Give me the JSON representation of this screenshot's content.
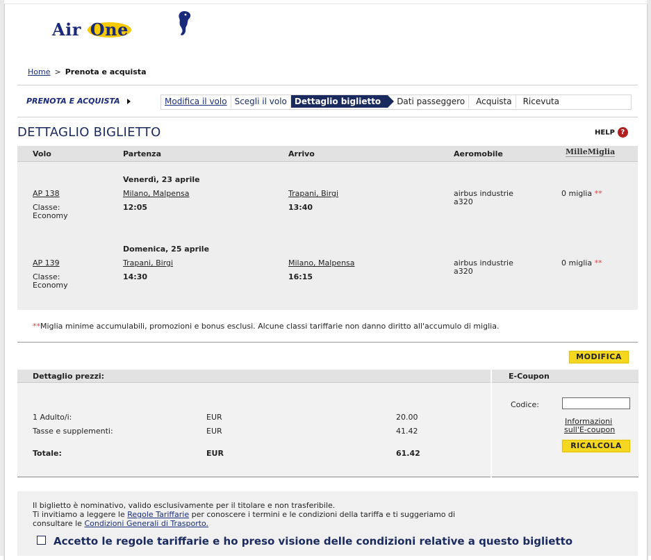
{
  "brand": {
    "name_part1": "Air ",
    "name_part2": "One",
    "accent": "#f7c900",
    "navy": "#1a2a5e"
  },
  "breadcrumb": {
    "home": "Home",
    "separator": ">",
    "current": "Prenota e acquista"
  },
  "wizard": {
    "label": "PRENOTA E ACQUISTA",
    "steps": [
      "Modifica il volo",
      "Scegli il volo",
      "Dettaglio biglietto",
      "Dati passeggero",
      "Acquista",
      "Ricevuta"
    ],
    "active_index": 2
  },
  "page": {
    "title": "DETTAGLIO BIGLIETTO",
    "help": "HELP",
    "help_icon": "?"
  },
  "flights": {
    "headers": {
      "volo": "Volo",
      "partenza": "Partenza",
      "arrivo": "Arrivo",
      "aeromobile": "Aeromobile",
      "millemiglia": "MilleMiglia"
    },
    "rows": [
      {
        "date": "Venerdì, 23 aprile",
        "flight": "AP 138",
        "class_label": "Classe:",
        "class_value": "Economy",
        "from": "Milano, Malpensa",
        "dep_time": "12:05",
        "to": "Trapani, Birgi",
        "arr_time": "13:40",
        "aircraft_1": "airbus industrie",
        "aircraft_2": "a320",
        "miles": "0 miglia",
        "miles_mark": "**"
      },
      {
        "date": "Domenica, 25 aprile",
        "flight": "AP 139",
        "class_label": "Classe:",
        "class_value": "Economy",
        "from": "Trapani, Birgi",
        "dep_time": "14:30",
        "to": "Milano, Malpensa",
        "arr_time": "16:15",
        "aircraft_1": "airbus industrie",
        "aircraft_2": "a320",
        "miles": "0 miglia",
        "miles_mark": "**"
      }
    ],
    "note_mark": "**",
    "note": "Miglia minime accumulabili, promozioni e bonus esclusi. Alcune classi tariffarie non danno diritto all'accumulo di miglia."
  },
  "buttons": {
    "modifica": "MODIFICA",
    "ricalcola": "RICALCOLA"
  },
  "prices": {
    "header": "Dettaglio prezzi:",
    "rows": [
      {
        "label": "1 Adulto/i:",
        "currency": "EUR",
        "amount": "20.00"
      },
      {
        "label": "Tasse e supplementi:",
        "currency": "EUR",
        "amount": "41.42"
      }
    ],
    "total": {
      "label": "Totale:",
      "currency": "EUR",
      "amount": "61.42"
    }
  },
  "coupon": {
    "header": "E-Coupon",
    "code_label": "Codice:",
    "code_value": "",
    "info_line1": "Informazioni",
    "info_line2": "sull'E-coupon"
  },
  "terms": {
    "line1": "Il biglietto è nominativo, valido esclusivamente per il titolare e non trasferibile.",
    "line2_pre": "Ti invitiamo a leggere le ",
    "line2_link": "Regole Tariffarie",
    "line2_post": " per conoscere i termini e le condizioni della tariffa e ti suggeriamo di",
    "line3_pre": "consultare le ",
    "line3_link": "Condizioni Generali di Trasporto.",
    "accept": "Accetto le regole tariffarie e ho preso visione delle condizioni relative a questo biglietto",
    "accepted": false
  }
}
